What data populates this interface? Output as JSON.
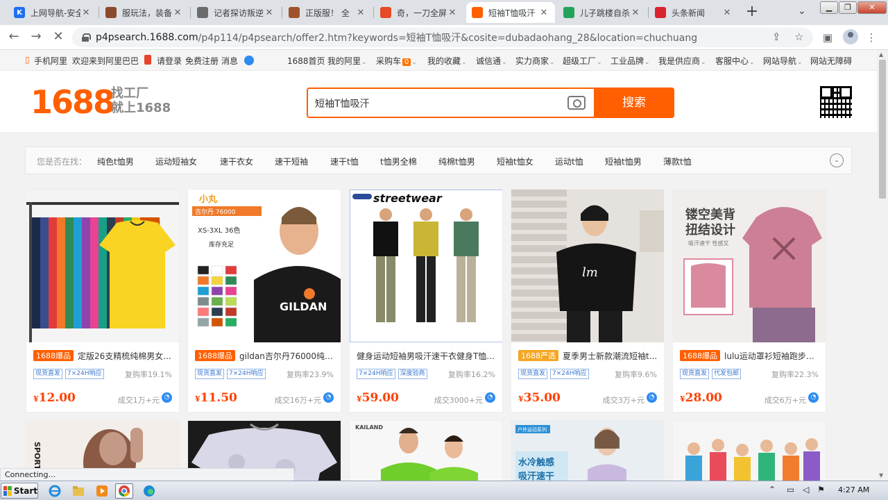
{
  "browser": {
    "tabs": [
      {
        "title": "上网导航-安全",
        "color": "#1f6ff2",
        "glyph": "K"
      },
      {
        "title": "服玩法，装备",
        "color": "#8b4a2b",
        "glyph": ""
      },
      {
        "title": "记者探访叛逆",
        "color": "#6b6b6b",
        "glyph": ""
      },
      {
        "title": "正版服！ 全",
        "color": "#a0522d",
        "glyph": ""
      },
      {
        "title": "奇，一刀全屏",
        "color": "#e84a27",
        "glyph": ""
      },
      {
        "title": "短袖T恤吸汗",
        "color": "#ff5f00",
        "glyph": ""
      },
      {
        "title": "儿子跳楼自杀",
        "color": "#22a35a",
        "glyph": ""
      },
      {
        "title": "头条新闻",
        "color": "#d9232d",
        "glyph": ""
      }
    ],
    "active_tab": 5,
    "close_glyph": "✕",
    "newtab_glyph": "+",
    "url_host": "p4psearch.1688.com",
    "url_path": "/p4p114/p4psearch/offer2.htm?keywords=短袖T恤吸汗&cosite=dubadaohang_28&location=chuchuang",
    "status_text": "Connecting..."
  },
  "topnav": {
    "left": [
      {
        "label": "手机阿里"
      },
      {
        "label": "欢迎来到阿里巴巴"
      },
      {
        "label": "请登录"
      },
      {
        "label": "免费注册"
      },
      {
        "label": "消息"
      }
    ],
    "right": [
      {
        "label": "1688首页"
      },
      {
        "label": "我的阿里"
      },
      {
        "label": "采购车"
      },
      {
        "label": "我的收藏"
      },
      {
        "label": "诚信通"
      },
      {
        "label": "实力商家"
      },
      {
        "label": "超级工厂"
      },
      {
        "label": "工业品牌"
      },
      {
        "label": "我是供应商"
      },
      {
        "label": "客服中心"
      },
      {
        "label": "网站导航"
      },
      {
        "label": "网站无障碍"
      }
    ],
    "cart_count": "0"
  },
  "header": {
    "logo": "1688",
    "slogan_line1": "找工厂",
    "slogan_line2": "就上1688",
    "search_value": "短袖T恤吸汗",
    "search_button": "搜索"
  },
  "suggest": {
    "label": "您是否在找：",
    "keywords": [
      "纯色t恤男",
      "运动短袖女",
      "速干衣女",
      "速干短袖",
      "速干t恤",
      "t恤男全棉",
      "纯棉t恤男",
      "短袖t恤女",
      "运动t恤",
      "短袖t恤男",
      "薄款t恤"
    ]
  },
  "products": [
    {
      "tag": "1688爆品",
      "tag_style": "orange",
      "title": "定版26支精梳纯棉男女...",
      "services": [
        "现货直发",
        "7×24H响应"
      ],
      "repurchase": "复购率19.1%",
      "price": "12.00",
      "sold": "成交1万+元"
    },
    {
      "tag": "1688爆品",
      "tag_style": "orange",
      "title": "gildan吉尔丹76000纯色...",
      "services": [
        "现货直发",
        "7×24H响应"
      ],
      "repurchase": "复购率23.9%",
      "price": "11.50",
      "sold": "成交16万+元"
    },
    {
      "tag": "",
      "tag_style": "none",
      "title": "健身运动短袖男吸汗速干衣健身T恤...",
      "services": [
        "7×24H响应",
        "深度验商"
      ],
      "repurchase": "复购率16.2%",
      "price": "59.00",
      "sold": "成交3000+元"
    },
    {
      "tag": "1688严选",
      "tag_style": "yellow",
      "title": "夏季男士新款潮流短袖t...",
      "services": [
        "现货直发",
        "7×24H响应"
      ],
      "repurchase": "复购率9.6%",
      "price": "35.00",
      "sold": "成交3万+元"
    },
    {
      "tag": "1688爆品",
      "tag_style": "orange",
      "title": "lulu运动罩衫短袖跑步衣...",
      "services": [
        "现货直发",
        "代发包邮"
      ],
      "repurchase": "复购率22.3%",
      "price": "28.00",
      "sold": "成交6万+元"
    }
  ],
  "image_texts": {
    "p2_brand": "小丸",
    "p2_model": "吉尔丹 76000",
    "p2_size": "XS-3XL 36色",
    "p2_stock": "库存充足",
    "p2_shirt": "GILDAN",
    "p3_banner": "streetwear",
    "p5_line1": "镂空美背",
    "p5_line2": "扭结设计",
    "p5_sub": "吸汗速干 性感又",
    "r2_sport": "SPORT",
    "r2_brand": "KAILAND",
    "r2_badge": "户外运动系列",
    "r2_text1": "水冷触感",
    "r2_text2": "吸汗速干"
  },
  "currency": "¥",
  "taskbar": {
    "start": "Start",
    "clock": "4:27 AM"
  },
  "colors": {
    "accent": "#ff5f00",
    "price": "#ff4000"
  }
}
